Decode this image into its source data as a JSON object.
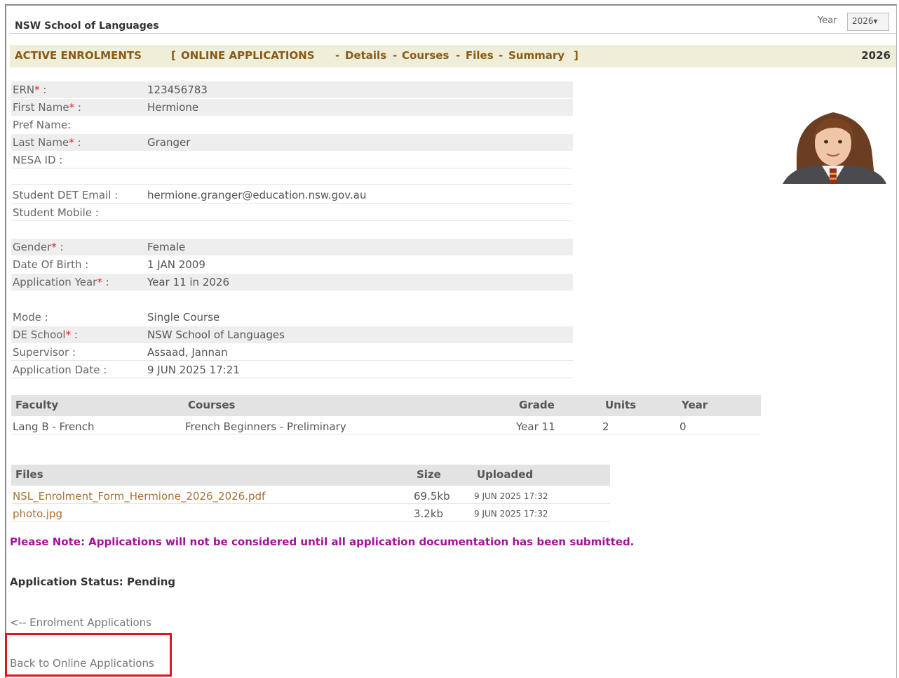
{
  "header": {
    "school_title": "NSW School of Languages",
    "year_label": "Year",
    "year_select": "2026",
    "year_select_arrow": "▾"
  },
  "nav": {
    "active_enrolments": "ACTIVE ENROLMENTS",
    "bracket_open": "[",
    "online_applications": "ONLINE APPLICATIONS",
    "sep": "-",
    "details": "Details",
    "courses": "Courses",
    "files": "Files",
    "summary": "Summary",
    "bracket_close": "]",
    "year": "2026"
  },
  "details": [
    {
      "label": "ERN",
      "required": true,
      "value": "123456783"
    },
    {
      "label": "First Name",
      "required": true,
      "value": "Hermione"
    },
    {
      "label": "Pref Name:",
      "required": false,
      "value": ""
    },
    {
      "label": "Last Name",
      "required": true,
      "value": "Granger"
    },
    {
      "label": "NESA ID :",
      "required": false,
      "value": ""
    },
    {
      "label": "Student DET Email :",
      "required": false,
      "value": "hermione.granger@education.nsw.gov.au"
    },
    {
      "label": "Student Mobile :",
      "required": false,
      "value": ""
    },
    {
      "label": "Gender",
      "required": true,
      "value": "Female"
    },
    {
      "label": "Date Of Birth :",
      "required": false,
      "value": "1 JAN 2009"
    },
    {
      "label": "Application Year",
      "required": true,
      "value": "Year 11 in 2026"
    },
    {
      "label": "Mode :",
      "required": false,
      "value": "Single Course"
    },
    {
      "label": "DE School",
      "required": true,
      "value": "NSW School of Languages"
    },
    {
      "label": "Supervisor :",
      "required": false,
      "value": "Assaad, Jannan"
    },
    {
      "label": "Application Date :",
      "required": false,
      "value": "9 JUN 2025 17:21"
    }
  ],
  "required_marker": "*",
  "required_suffix": " :",
  "courses_table": {
    "headers": [
      "Faculty",
      "Courses",
      "Grade",
      "Units",
      "Year"
    ],
    "rows": [
      [
        "Lang B - French",
        "French Beginners - Preliminary",
        "Year 11",
        "2",
        "0"
      ]
    ]
  },
  "files_table": {
    "headers": [
      "Files",
      "Size",
      "Uploaded"
    ],
    "rows": [
      [
        "NSL_Enrolment_Form_Hermione_2026_2026.pdf",
        "69.5kb",
        "9 JUN 2025 17:32"
      ],
      [
        "photo.jpg",
        "3.2kb",
        "9 JUN 2025 17:32"
      ]
    ]
  },
  "note": "Please Note: Applications will not be considered until all application documentation has been submitted.",
  "status": "Application Status: Pending",
  "links": {
    "back_enrolments": "<-- Enrolment Applications",
    "back_online": "Back to Online Applications"
  },
  "colors": {
    "nav_text": "#8a5a16",
    "nav_bg": "#eeeed9",
    "required": "#e0202a",
    "note": "#a3129a",
    "file_link": "#a8712e",
    "highlight": "#e0141c"
  }
}
